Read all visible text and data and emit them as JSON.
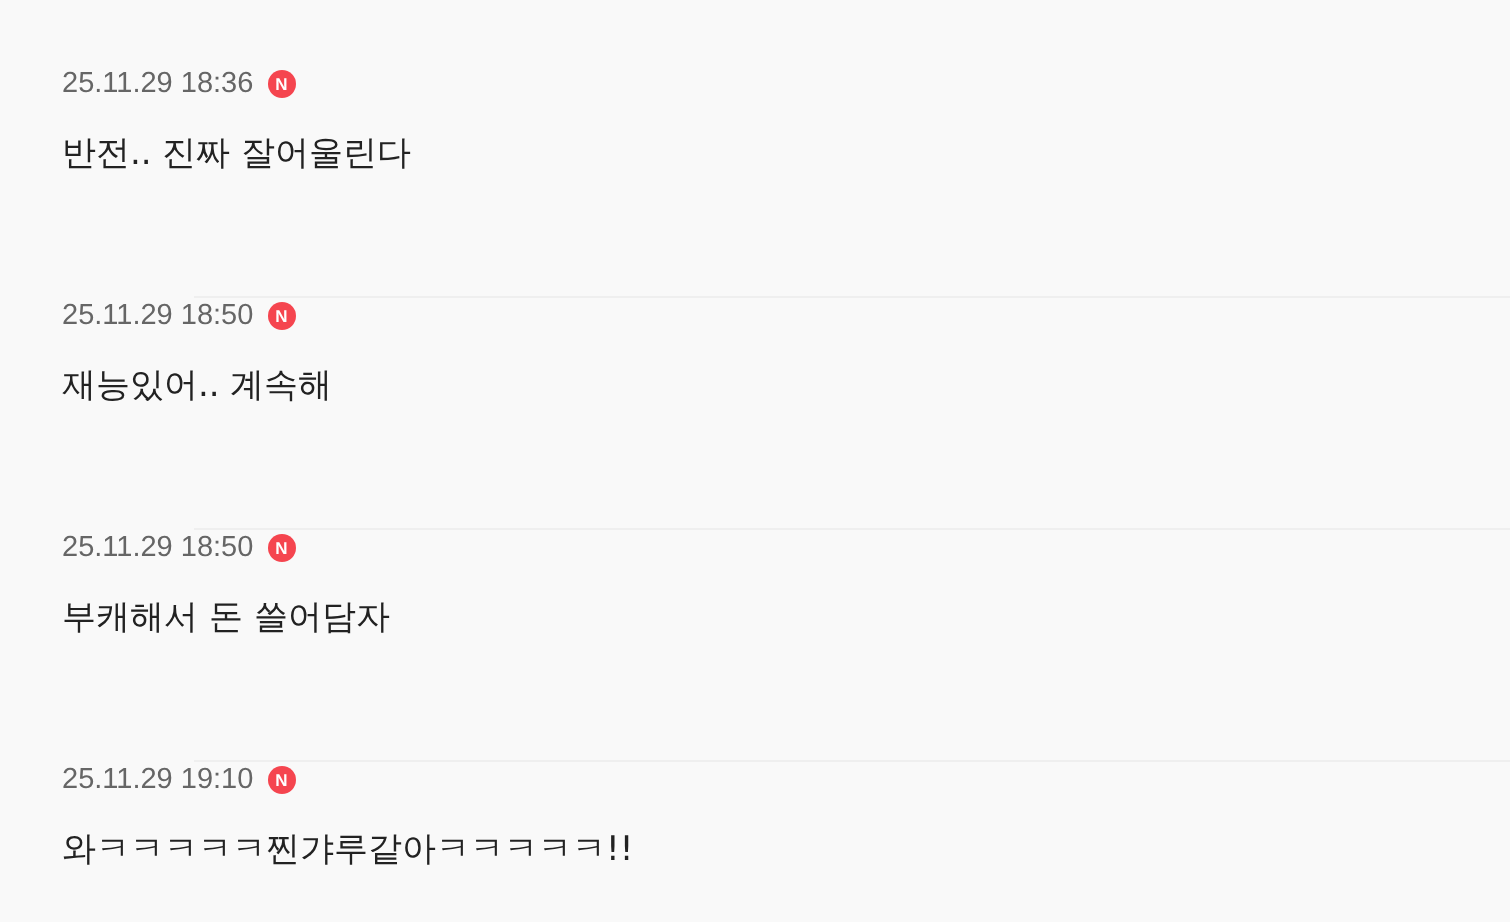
{
  "comments": [
    {
      "time": "25.11.29 18:36",
      "badge": "N",
      "text": "반전.. 진짜 잘어울린다"
    },
    {
      "time": "25.11.29 18:50",
      "badge": "N",
      "text": "재능있어.. 계속해"
    },
    {
      "time": "25.11.29 18:50",
      "badge": "N",
      "text": "부캐해서 돈 쓸어담자"
    },
    {
      "time": "25.11.29 19:10",
      "badge": "N",
      "text": "와ㅋㅋㅋㅋㅋ찐갸루같아ㅋㅋㅋㅋㅋ!!"
    }
  ]
}
